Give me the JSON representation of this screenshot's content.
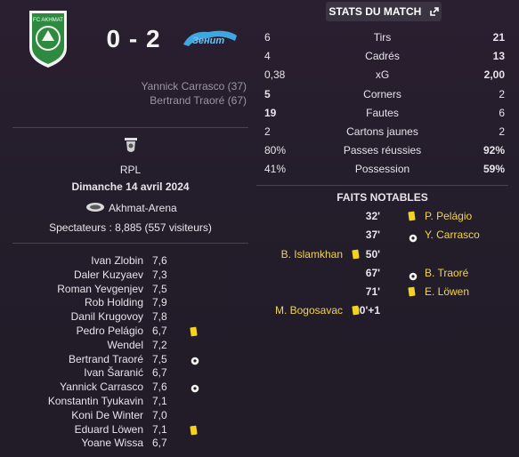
{
  "tab": {
    "label": "STATS DU MATCH"
  },
  "match": {
    "score": "0 - 2",
    "home_logo_text": "FC AKHMAT",
    "away_logo_text": "Зенит",
    "scorers": [
      "Yannick Carrasco (37)",
      "Bertrand Traoré (67)"
    ],
    "competition": "RPL",
    "date": "Dimanche 14 avril 2024",
    "stadium": "Akhmat-Arena",
    "attendance": "Spectateurs : 8,885 (557 visiteurs)"
  },
  "stats": [
    {
      "home": "6",
      "label": "Tirs",
      "away": "21"
    },
    {
      "home": "4",
      "label": "Cadrés",
      "away": "13"
    },
    {
      "home": "0,38",
      "label": "xG",
      "away": "2,00"
    },
    {
      "home": "5",
      "label": "Corners",
      "away": "2"
    },
    {
      "home": "19",
      "label": "Fautes",
      "away": "6"
    },
    {
      "home": "2",
      "label": "Cartons jaunes",
      "away": "2"
    },
    {
      "home": "80%",
      "label": "Passes réussies",
      "away": "92%"
    },
    {
      "home": "41%",
      "label": "Possession",
      "away": "59%"
    }
  ],
  "events_title": "FAITS NOTABLES",
  "events": [
    {
      "minute": "32'",
      "side": "away",
      "type": "yellow-card",
      "player": "P. Pelágio"
    },
    {
      "minute": "37'",
      "side": "away",
      "type": "goal",
      "player": "Y. Carrasco"
    },
    {
      "minute": "50'",
      "side": "home",
      "type": "yellow-card",
      "player": "B. Islamkhan"
    },
    {
      "minute": "67'",
      "side": "away",
      "type": "goal",
      "player": "B. Traoré"
    },
    {
      "minute": "71'",
      "side": "away",
      "type": "yellow-card",
      "player": "E. Löwen"
    },
    {
      "minute": "90'+1",
      "side": "home",
      "type": "yellow-card",
      "player": "M. Bogosavac"
    }
  ],
  "lineup": [
    {
      "name": "Ivan Zlobin",
      "rating": "7,6",
      "icon": ""
    },
    {
      "name": "Daler Kuzyaev",
      "rating": "7,3",
      "icon": ""
    },
    {
      "name": "Roman Yevgenjev",
      "rating": "7,5",
      "icon": ""
    },
    {
      "name": "Rob Holding",
      "rating": "7,9",
      "icon": ""
    },
    {
      "name": "Danil Krugovoy",
      "rating": "7,8",
      "icon": ""
    },
    {
      "name": "Pedro Pelágio",
      "rating": "6,7",
      "icon": "yellow-card"
    },
    {
      "name": "Wendel",
      "rating": "7,2",
      "icon": ""
    },
    {
      "name": "Bertrand Traoré",
      "rating": "7,5",
      "icon": "goal"
    },
    {
      "name": "Ivan Šaranić",
      "rating": "6,7",
      "icon": ""
    },
    {
      "name": "Yannick Carrasco",
      "rating": "7,6",
      "icon": "goal"
    },
    {
      "name": "Konstantin Tyukavin",
      "rating": "7,1",
      "icon": ""
    },
    {
      "name": "Koni De Winter",
      "rating": "7,0",
      "icon": ""
    },
    {
      "name": "Eduard Löwen",
      "rating": "7,1",
      "icon": "yellow-card"
    },
    {
      "name": "Yoane Wissa",
      "rating": "6,7",
      "icon": ""
    }
  ],
  "colors": {
    "home_crest": "#2e8a3f",
    "away_crest": "#3fa6e0",
    "yellow_card": "#f4d21f",
    "event_name": "#f3d44a"
  }
}
